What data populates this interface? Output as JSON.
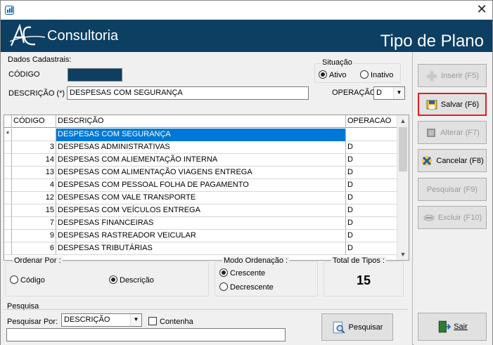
{
  "window": {
    "title": ""
  },
  "header": {
    "logo_text": "Consultoria",
    "title": "Tipo de Plano"
  },
  "form": {
    "section_label": "Dados Cadastrais:",
    "codigo_label": "CÓDIGO",
    "descricao_label": "DESCRIÇÃO (*)",
    "descricao_value": "DESPESAS COM SEGURANÇA",
    "situacao_label": "Situação",
    "ativo_label": "Ativo",
    "inativo_label": "Inativo",
    "situacao_selected": "Ativo",
    "operacao_label": "OPERAÇÃO",
    "operacao_value": "D"
  },
  "grid": {
    "columns": [
      "CÓDIGO",
      "DESCRIÇÃO",
      "OPERACAO"
    ],
    "new_row_marker": "*",
    "rows": [
      {
        "codigo": "",
        "descricao": "DESPESAS COM SEGURANÇA",
        "operacao": ""
      },
      {
        "codigo": "3",
        "descricao": "DESPESAS ADMINISTRATIVAS",
        "operacao": "D"
      },
      {
        "codigo": "14",
        "descricao": "DESPESAS COM ALIEMENTAÇÃO INTERNA",
        "operacao": "D"
      },
      {
        "codigo": "13",
        "descricao": "DESPESAS COM ALIMENTAÇÃO VIAGENS ENTREGA",
        "operacao": "D"
      },
      {
        "codigo": "4",
        "descricao": "DESPESAS COM PESSOAL FOLHA DE PAGAMENTO",
        "operacao": "D"
      },
      {
        "codigo": "12",
        "descricao": "DESPESAS COM VALE TRANSPORTE",
        "operacao": "D"
      },
      {
        "codigo": "15",
        "descricao": "DESPESAS COM VEÍCULOS ENTREGA",
        "operacao": "D"
      },
      {
        "codigo": "7",
        "descricao": "DESPESAS FINANCEIRAS",
        "operacao": "D"
      },
      {
        "codigo": "9",
        "descricao": "DESPESAS RASTREADOR VEICULAR",
        "operacao": "D"
      },
      {
        "codigo": "6",
        "descricao": "DESPESAS TRIBUTÁRIAS",
        "operacao": "D"
      }
    ]
  },
  "order": {
    "ordenar_label": "Ordenar Por :",
    "codigo_label": "Código",
    "descricao_label": "Descrição",
    "ordenar_selected": "Descrição",
    "modo_label": "Modo Ordenação :",
    "crescente_label": "Crescente",
    "decrescente_label": "Decrescente",
    "modo_selected": "Crescente",
    "total_label": "Total de Tipos :",
    "total_value": "15"
  },
  "search": {
    "section_label": "Pesquisa",
    "pesquisar_por_label": "Pesquisar Por:",
    "pesquisar_por_value": "DESCRIÇÃO",
    "contenha_label": "Contenha",
    "search_value": "",
    "button_label": "Pesquisar"
  },
  "buttons": {
    "inserir": "Inserir (F5)",
    "salvar": "Salvar (F6)",
    "alterar": "Alterar (F7)",
    "cancelar": "Cancelar (F8)",
    "pesquisar": "Pesquisar (F9)",
    "excluir": "Excluir (F10)",
    "sair": "Sair"
  },
  "colors": {
    "header_bg": "#0d3f63",
    "selected_row": "#0078d7",
    "focus_border": "#e02020"
  }
}
